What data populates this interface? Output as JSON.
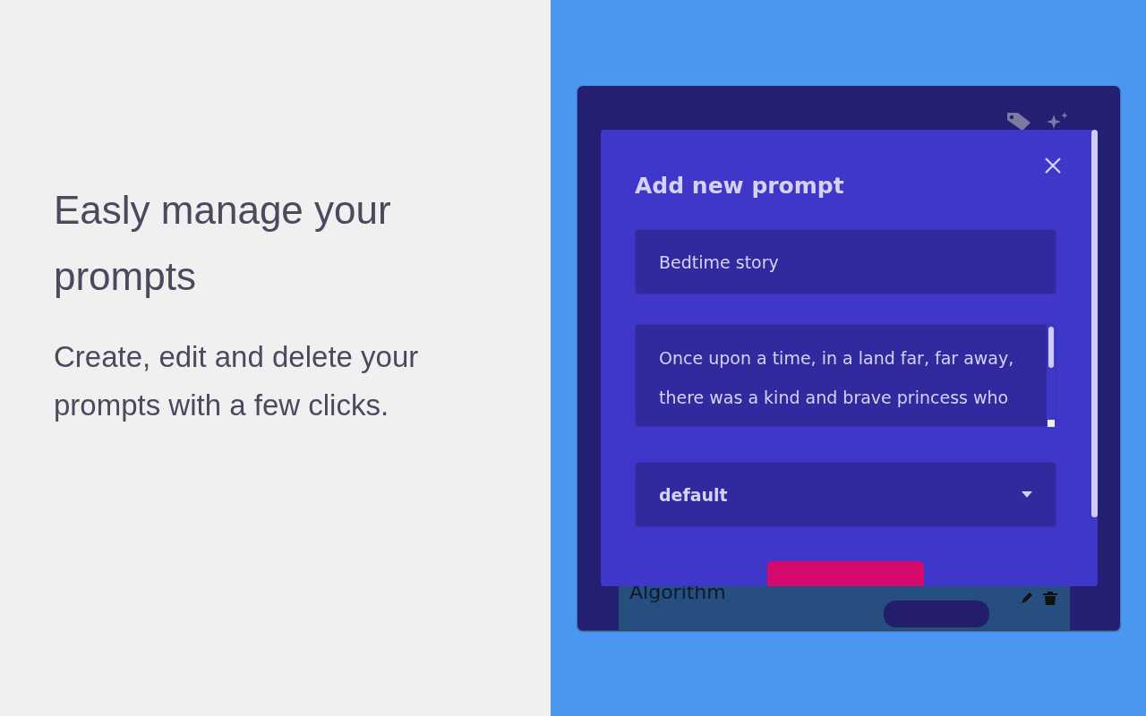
{
  "hero": {
    "title": "Easly manage your prompts",
    "subtitle": "Create, edit and delete your prompts with a few clicks."
  },
  "app": {
    "prompt_list": [
      {
        "title": "Algorithm"
      }
    ]
  },
  "dialog": {
    "title": "Add new prompt",
    "name_field": {
      "value": "Bedtime story"
    },
    "content_field": {
      "value": "Once upon a time, in a land far, far away, there was a kind and brave princess who"
    },
    "category_select": {
      "value": "default"
    }
  }
}
